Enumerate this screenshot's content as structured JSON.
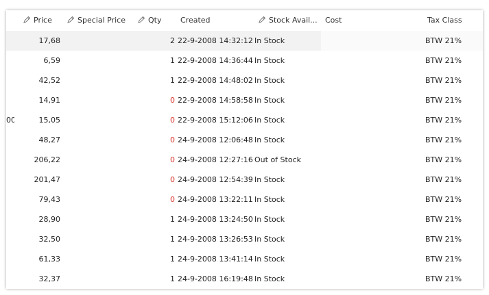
{
  "header": {
    "price": "Price",
    "special_price": "Special Price",
    "qty": "Qty",
    "created": "Created",
    "stock": "Stock Avail...",
    "cost": "Cost",
    "tax": "Tax Class"
  },
  "rows": [
    {
      "left": "",
      "price": "17,68",
      "qty": "2",
      "created": "22-9-2008 14:32:12",
      "stock": "In Stock",
      "tax": "BTW 21%"
    },
    {
      "left": "",
      "price": "6,59",
      "qty": "1",
      "created": "22-9-2008 14:36:44",
      "stock": "In Stock",
      "tax": "BTW 21%"
    },
    {
      "left": "",
      "price": "42,52",
      "qty": "1",
      "created": "22-9-2008 14:48:02",
      "stock": "In Stock",
      "tax": "BTW 21%"
    },
    {
      "left": "",
      "price": "14,91",
      "qty": "0",
      "created": "22-9-2008 14:58:58",
      "stock": "In Stock",
      "tax": "BTW 21%"
    },
    {
      "left": "00",
      "price": "15,05",
      "qty": "0",
      "created": "22-9-2008 15:12:06",
      "stock": "In Stock",
      "tax": "BTW 21%"
    },
    {
      "left": "",
      "price": "48,27",
      "qty": "0",
      "created": "24-9-2008 12:06:48",
      "stock": "In Stock",
      "tax": "BTW 21%"
    },
    {
      "left": "",
      "price": "206,22",
      "qty": "0",
      "created": "24-9-2008 12:27:16",
      "stock": "Out of Stock",
      "tax": "BTW 21%"
    },
    {
      "left": "",
      "price": "201,47",
      "qty": "0",
      "created": "24-9-2008 12:54:39",
      "stock": "In Stock",
      "tax": "BTW 21%"
    },
    {
      "left": "",
      "price": "79,43",
      "qty": "0",
      "created": "24-9-2008 13:22:11",
      "stock": "In Stock",
      "tax": "BTW 21%"
    },
    {
      "left": "",
      "price": "28,90",
      "qty": "1",
      "created": "24-9-2008 13:24:50",
      "stock": "In Stock",
      "tax": "BTW 21%"
    },
    {
      "left": "",
      "price": "32,50",
      "qty": "1",
      "created": "24-9-2008 13:26:53",
      "stock": "In Stock",
      "tax": "BTW 21%"
    },
    {
      "left": "",
      "price": "61,33",
      "qty": "1",
      "created": "24-9-2008 13:41:14",
      "stock": "In Stock",
      "tax": "BTW 21%"
    },
    {
      "left": "",
      "price": "32,37",
      "qty": "1",
      "created": "24-9-2008 16:19:48",
      "stock": "In Stock",
      "tax": "BTW 21%"
    }
  ],
  "colors": {
    "zero_qty": "#d9332c",
    "selected_row": "#f2f2f2",
    "grid_line": "#e6e6e6"
  },
  "icons": {
    "editable_column": "pencil-icon"
  }
}
